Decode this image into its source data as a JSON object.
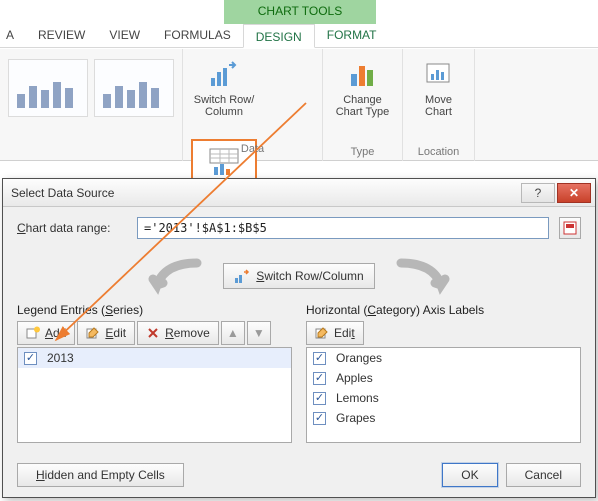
{
  "ribbon": {
    "contextual_title": "CHART TOOLS",
    "tabs": {
      "t0": "A",
      "review": "REVIEW",
      "view": "VIEW",
      "formulas": "FORMULAS",
      "design": "DESIGN",
      "format": "FORMAT"
    },
    "data_group": {
      "switch_row_col": "Switch Row/\nColumn",
      "select_data": "Select\nData",
      "label": "Data"
    },
    "type_group": {
      "change_type": "Change\nChart Type",
      "label": "Type"
    },
    "location_group": {
      "move_chart": "Move\nChart",
      "label": "Location"
    }
  },
  "dialog": {
    "title": "Select Data Source",
    "range_label": "Chart data range:",
    "range_value": "='2013'!$A$1:$B$5",
    "switch_btn": "Switch Row/Column",
    "series_title": "Legend Entries (Series)",
    "series_toolbar": {
      "add": "Add",
      "edit": "Edit",
      "remove": "Remove"
    },
    "series_items": [
      {
        "label": "2013",
        "checked": true
      }
    ],
    "axis_title": "Horizontal (Category) Axis Labels",
    "axis_toolbar": {
      "edit": "Edit"
    },
    "axis_items": [
      {
        "label": "Oranges",
        "checked": true
      },
      {
        "label": "Apples",
        "checked": true
      },
      {
        "label": "Lemons",
        "checked": true
      },
      {
        "label": "Grapes",
        "checked": true
      }
    ],
    "hidden_btn": "Hidden and Empty Cells",
    "ok": "OK",
    "cancel": "Cancel"
  }
}
